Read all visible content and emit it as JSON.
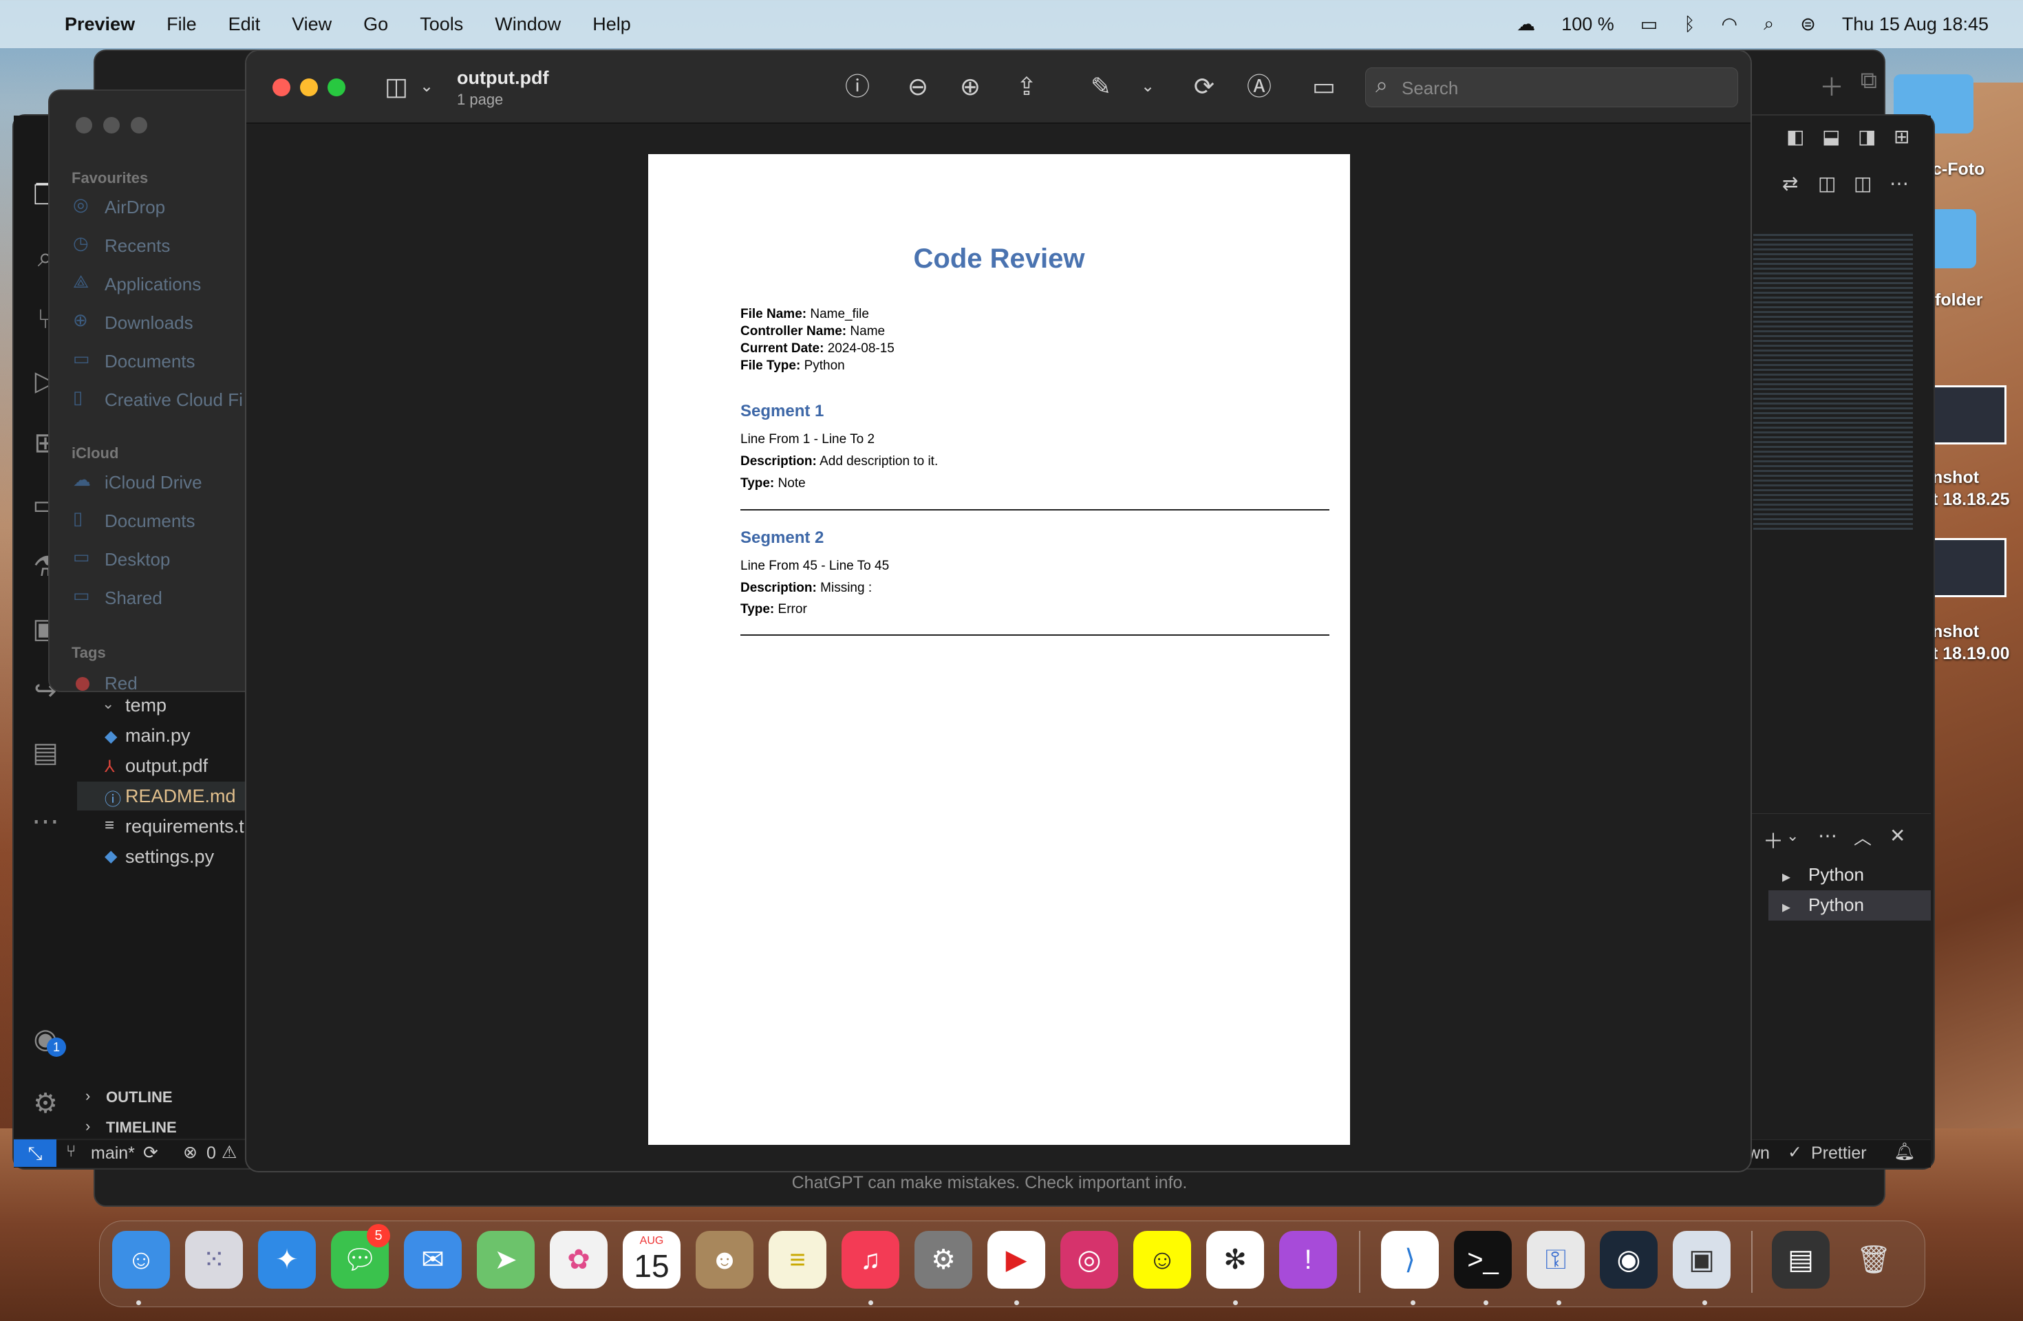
{
  "menubar": {
    "app": "Preview",
    "items": [
      "File",
      "Edit",
      "View",
      "Go",
      "Tools",
      "Window",
      "Help"
    ],
    "battery": "100 %",
    "datetime": "Thu 15 Aug  18:45"
  },
  "preview": {
    "filename": "output.pdf",
    "pages": "1 page",
    "search_placeholder": "Search"
  },
  "document": {
    "title": "Code Review",
    "meta": [
      {
        "label": "File Name:",
        "value": "Name_file"
      },
      {
        "label": "Controller Name:",
        "value": "Name"
      },
      {
        "label": "Current Date:",
        "value": "2024-08-15"
      },
      {
        "label": "File Type:",
        "value": "Python"
      }
    ],
    "segments": [
      {
        "title": "Segment 1",
        "lines": "Line From 1 - Line To 2",
        "desc_label": "Description:",
        "desc": "Add description to it.",
        "type_label": "Type:",
        "type": "Note"
      },
      {
        "title": "Segment 2",
        "lines": "Line From 45 - Line To 45",
        "desc_label": "Description:",
        "desc": "Missing :",
        "type_label": "Type:",
        "type": "Error"
      }
    ]
  },
  "finder": {
    "favourites_header": "Favourites",
    "favourites": [
      "AirDrop",
      "Recents",
      "Applications",
      "Downloads",
      "Documents",
      "Creative Cloud Fi"
    ],
    "icloud_header": "iCloud",
    "icloud": [
      "iCloud Drive",
      "Documents",
      "Desktop",
      "Shared"
    ],
    "tags_header": "Tags",
    "tags": [
      "Red"
    ]
  },
  "vscode": {
    "files": [
      "temp",
      "main.py",
      "output.pdf",
      "README.md",
      "requirements.t",
      "settings.py"
    ],
    "outline": "OUTLINE",
    "timeline": "TIMELINE",
    "branch": "main*",
    "problems": "0",
    "terminals": [
      "Python",
      "Python"
    ],
    "prettier": "Prettier",
    "status_fragment": "wn",
    "account_badge": "1"
  },
  "chatgpt": {
    "footer": "ChatGPT can make mistakes. Check important info."
  },
  "desktop": {
    "labels": [
      "c-Foto",
      "folder",
      "nshot",
      "t 18.18.25",
      "nshot",
      "t 18.19.00"
    ]
  },
  "dock": {
    "messages_badge": "5",
    "calendar_month": "AUG",
    "calendar_day": "15"
  }
}
